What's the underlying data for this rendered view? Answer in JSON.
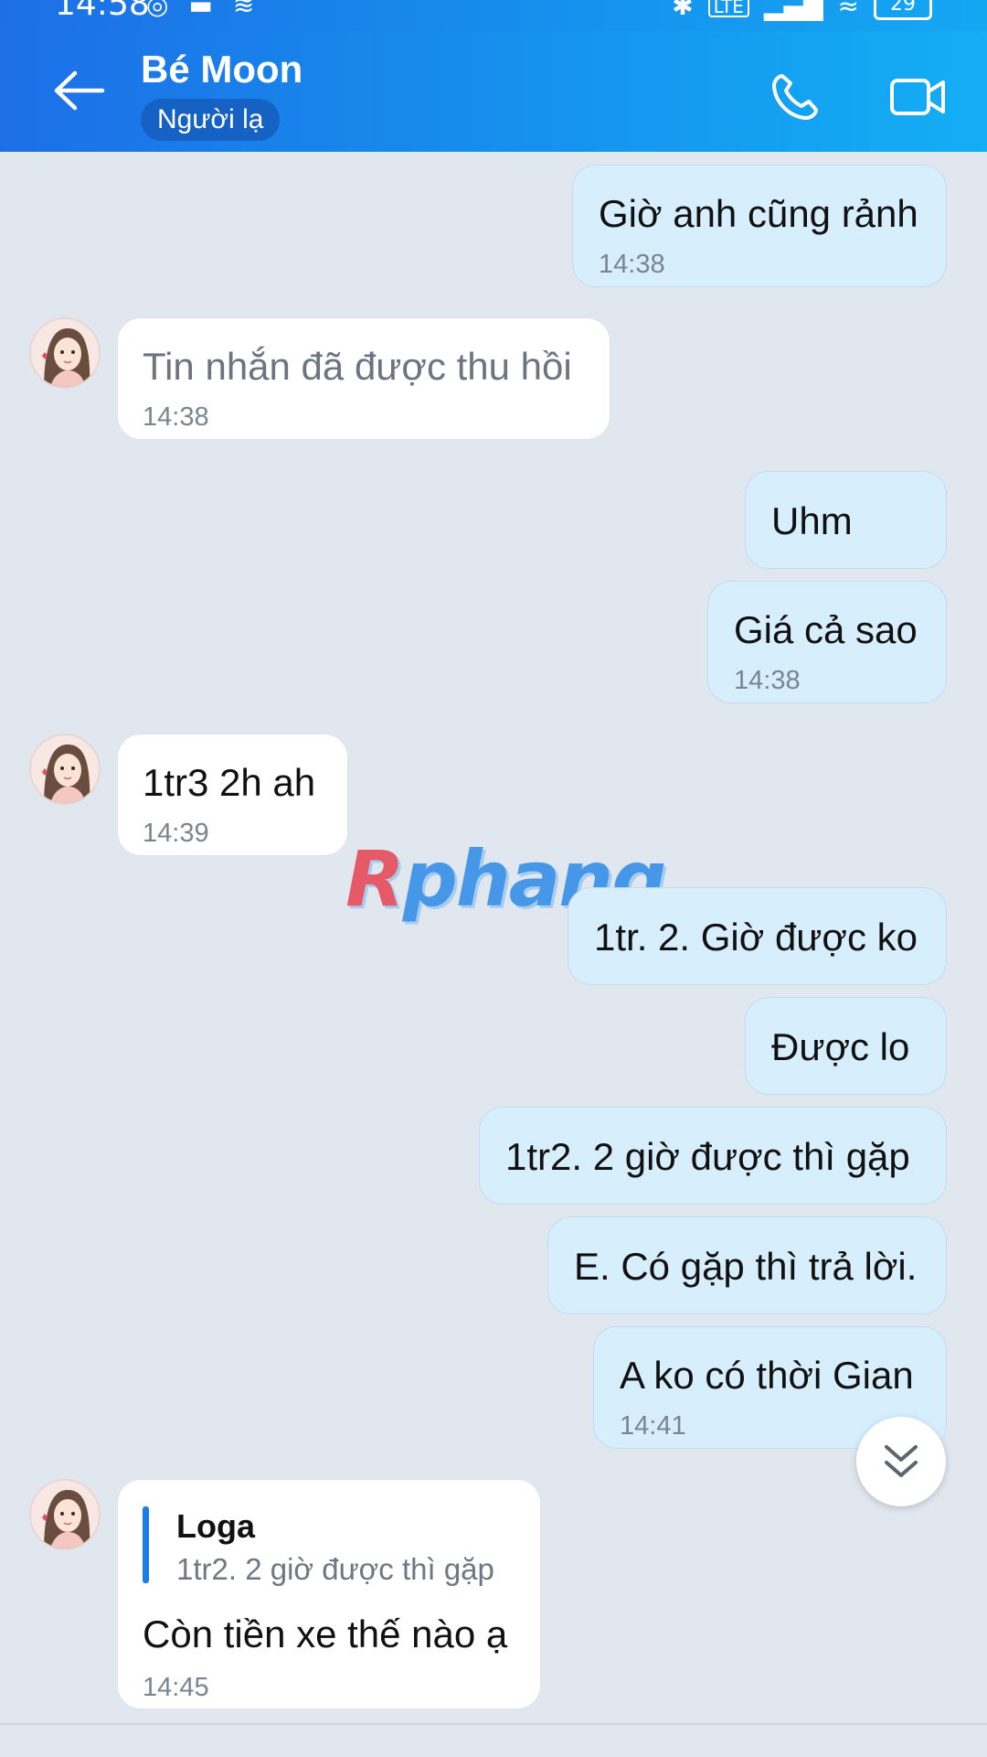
{
  "status_bar": {
    "time": "14:58",
    "network": "LTE",
    "battery": "29"
  },
  "header": {
    "contact_name": "Bé Moon",
    "badge": "Người lạ"
  },
  "messages": [
    {
      "from": "me",
      "text": "Giờ anh cũng rảnh",
      "time": "14:38"
    },
    {
      "from": "them",
      "text": "Tin nhắn đã được thu hồi",
      "time": "14:38"
    },
    {
      "from": "me",
      "text": "Uhm"
    },
    {
      "from": "me",
      "text": "Giá cả sao",
      "time": "14:38"
    },
    {
      "from": "them",
      "text": "1tr3 2h ah",
      "time": "14:39"
    },
    {
      "from": "me",
      "text": "1tr. 2. Giờ được ko"
    },
    {
      "from": "me",
      "text": "Được lo"
    },
    {
      "from": "me",
      "text": "1tr2. 2 giờ được thì gặp"
    },
    {
      "from": "me",
      "text": "E. Có gặp thì trả lời."
    },
    {
      "from": "me",
      "text": "A ko có thời Gian",
      "time": "14:41"
    },
    {
      "from": "them",
      "text": "Còn tiền xe thế nào ạ",
      "time": "14:45",
      "quote": {
        "author": "Loga",
        "text": "1tr2. 2 giờ được thì gặp"
      }
    }
  ],
  "watermark": {
    "first": "R",
    "rest": "phang"
  },
  "icons": {
    "back": "arrow-left-icon",
    "call": "phone-icon",
    "video": "video-camera-icon",
    "scroll": "double-chevron-down-icon"
  },
  "colors": {
    "header_start": "#1d6fe6",
    "header_end": "#14aef4",
    "my_bubble": "#d7eefc",
    "their_bubble": "#ffffff",
    "background": "#e1e7ef"
  }
}
